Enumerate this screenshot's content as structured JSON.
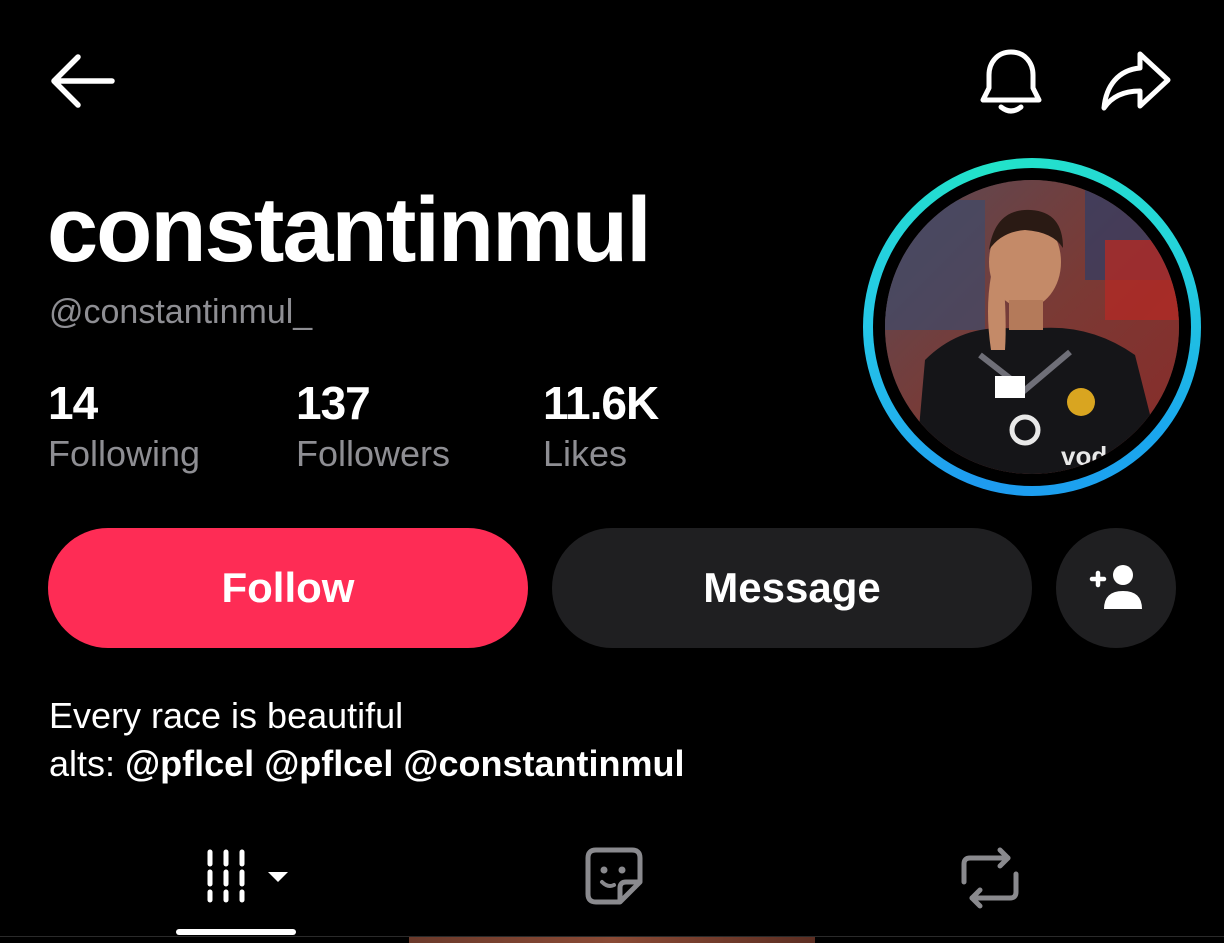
{
  "header": {
    "back_icon": "arrow-left-icon",
    "bell_icon": "bell-icon",
    "share_icon": "share-arrow-icon"
  },
  "profile": {
    "display_name": "constantinmul",
    "handle": "@constantinmul_",
    "avatar_description_colors": {
      "ring_start": "#1e9bf0",
      "ring_end": "#22e3c9"
    }
  },
  "stats": {
    "following": {
      "count": "14",
      "label": "Following"
    },
    "followers": {
      "count": "137",
      "label": "Followers"
    },
    "likes": {
      "count": "11.6K",
      "label": "Likes"
    }
  },
  "actions": {
    "follow_label": "Follow",
    "message_label": "Message",
    "add_friend_icon": "add-person-icon"
  },
  "bio": {
    "line1": "Every race is beautiful",
    "line2_prefix": "alts: ",
    "mentions": [
      "@pflcel",
      "@pflcel",
      "@constantinmul"
    ]
  },
  "tabs": [
    {
      "icon": "videos-grid-icon",
      "selected": true
    },
    {
      "icon": "liked-sticker-icon",
      "selected": false
    },
    {
      "icon": "repost-icon",
      "selected": false
    }
  ],
  "colors": {
    "accent": "#fe2c55",
    "secondary_button": "#1f1f21",
    "muted_text": "#8e8e93",
    "background": "#000000"
  }
}
